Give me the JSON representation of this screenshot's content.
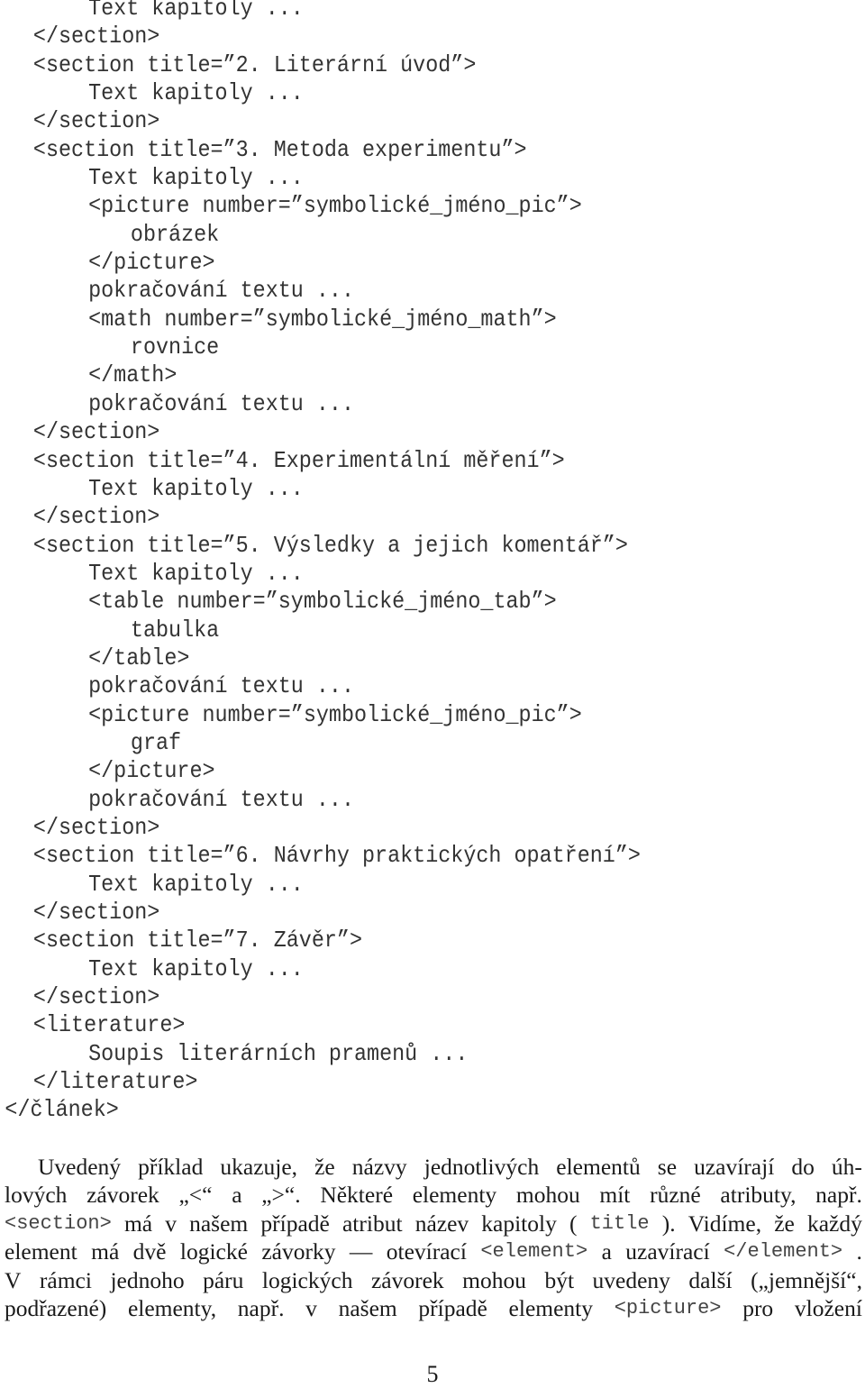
{
  "code_listing": {
    "lines": [
      {
        "indent": 2,
        "text": "Text kapitoly ..."
      },
      {
        "indent": 1,
        "text": "</section>"
      },
      {
        "indent": 1,
        "text": "<section title=”2. Literární úvod”>"
      },
      {
        "indent": 2,
        "text": "Text kapitoly ..."
      },
      {
        "indent": 1,
        "text": "</section>"
      },
      {
        "indent": 1,
        "text": "<section title=”3. Metoda experimentu”>"
      },
      {
        "indent": 2,
        "text": "Text kapitoly ..."
      },
      {
        "indent": 2,
        "text": "<picture number=”symbolické_jméno_pic”>"
      },
      {
        "indent": 3,
        "text": "obrázek"
      },
      {
        "indent": 2,
        "text": "</picture>"
      },
      {
        "indent": 2,
        "text": "pokračování textu ..."
      },
      {
        "indent": 2,
        "text": "<math number=”symbolické_jméno_math”>"
      },
      {
        "indent": 3,
        "text": "rovnice"
      },
      {
        "indent": 2,
        "text": "</math>"
      },
      {
        "indent": 2,
        "text": "pokračování textu ..."
      },
      {
        "indent": 1,
        "text": "</section>"
      },
      {
        "indent": 1,
        "text": "<section title=”4. Experimentální měření”>"
      },
      {
        "indent": 2,
        "text": "Text kapitoly ..."
      },
      {
        "indent": 1,
        "text": "</section>"
      },
      {
        "indent": 1,
        "text": "<section title=”5. Výsledky a jejich komentář”>"
      },
      {
        "indent": 2,
        "text": "Text kapitoly ..."
      },
      {
        "indent": 2,
        "text": "<table number=”symbolické_jméno_tab”>"
      },
      {
        "indent": 3,
        "text": "tabulka"
      },
      {
        "indent": 2,
        "text": "</table>"
      },
      {
        "indent": 2,
        "text": "pokračování textu ..."
      },
      {
        "indent": 2,
        "text": "<picture number=”symbolické_jméno_pic”>"
      },
      {
        "indent": 3,
        "text": "graf"
      },
      {
        "indent": 2,
        "text": "</picture>"
      },
      {
        "indent": 2,
        "text": "pokračování textu ..."
      },
      {
        "indent": 1,
        "text": "</section>"
      },
      {
        "indent": 1,
        "text": "<section title=”6. Návrhy praktických opatření”>"
      },
      {
        "indent": 2,
        "text": "Text kapitoly ..."
      },
      {
        "indent": 1,
        "text": "</section>"
      },
      {
        "indent": 1,
        "text": "<section title=”7. Závěr”>"
      },
      {
        "indent": 2,
        "text": "Text kapitoly ..."
      },
      {
        "indent": 1,
        "text": "</section>"
      },
      {
        "indent": 1,
        "text": "<literature>"
      },
      {
        "indent": 2,
        "text": "Soupis literárních pramenů ..."
      },
      {
        "indent": 1,
        "text": "</literature>"
      },
      {
        "indent": 0,
        "text": "</článek>"
      }
    ]
  },
  "paragraph": {
    "lines": [
      {
        "indent": true,
        "segments": [
          {
            "type": "text",
            "text": "Uvedený příklad ukazuje, že názvy jednotlivých elementů se uzavírají do úh-"
          }
        ]
      },
      {
        "indent": false,
        "segments": [
          {
            "type": "text",
            "text": "lových závorek „<“ a „>“. Některé elementy mohou mít různé atributy, např."
          }
        ]
      },
      {
        "indent": false,
        "segments": [
          {
            "type": "code",
            "text": "<section>"
          },
          {
            "type": "text",
            "text": " má v našem případě atribut název kapitoly ("
          },
          {
            "type": "code",
            "text": "title"
          },
          {
            "type": "text",
            "text": "). Vidíme, že každý"
          }
        ]
      },
      {
        "indent": false,
        "segments": [
          {
            "type": "text",
            "text": "element má dvě logické závorky — otevírací "
          },
          {
            "type": "code",
            "text": "<element>"
          },
          {
            "type": "text",
            "text": " a uzavírací "
          },
          {
            "type": "code",
            "text": "</element>"
          },
          {
            "type": "text",
            "text": "."
          }
        ]
      },
      {
        "indent": false,
        "segments": [
          {
            "type": "text",
            "text": "V rámci jednoho páru logických závorek mohou být uvedeny další („jemnější“,"
          }
        ]
      },
      {
        "indent": false,
        "segments": [
          {
            "type": "text",
            "text": "podřazené) elementy, např. v našem případě elementy "
          },
          {
            "type": "code",
            "text": "<picture>"
          },
          {
            "type": "text",
            "text": " pro vložení"
          }
        ]
      }
    ]
  },
  "page_number": "5"
}
